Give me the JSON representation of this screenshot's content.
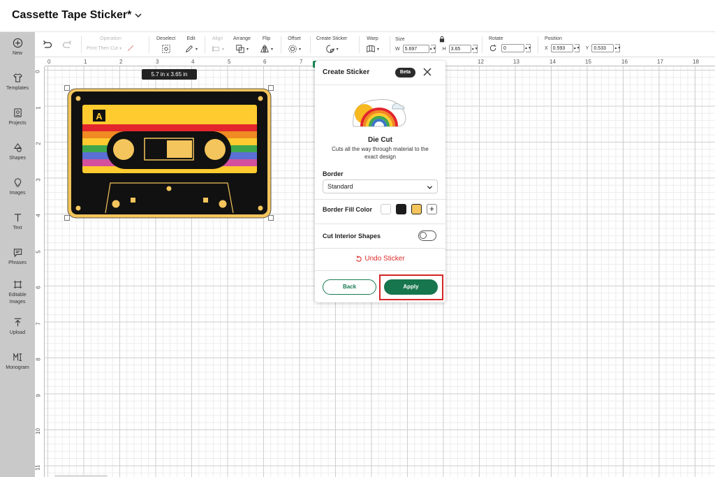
{
  "header": {
    "title": "Cassette Tape Sticker*"
  },
  "rail": [
    {
      "label": "New",
      "icon": "plus-circle-icon"
    },
    {
      "label": "Templates",
      "icon": "shirt-icon"
    },
    {
      "label": "Projects",
      "icon": "projects-icon"
    },
    {
      "label": "Shapes",
      "icon": "shapes-icon"
    },
    {
      "label": "Images",
      "icon": "lightbulb-icon"
    },
    {
      "label": "Text",
      "icon": "text-icon"
    },
    {
      "label": "Phrases",
      "icon": "speech-bubble-icon"
    },
    {
      "label": "Editable Images",
      "icon": "editable-images-icon"
    },
    {
      "label": "Upload",
      "icon": "upload-icon"
    },
    {
      "label": "Monogram",
      "icon": "monogram-icon"
    }
  ],
  "toolbar": {
    "operation_label": "Operation",
    "operation_value": "Print Then Cut",
    "deselect_label": "Deselect",
    "edit_label": "Edit",
    "align_label": "Align",
    "arrange_label": "Arrange",
    "flip_label": "Flip",
    "offset_label": "Offset",
    "create_sticker_label": "Create Sticker",
    "warp_label": "Warp",
    "size_label": "Size",
    "size_w_label": "W",
    "size_w": "5.697",
    "size_h_label": "H",
    "size_h": "3.65",
    "rotate_label": "Rotate",
    "rotate_value": "0",
    "position_label": "Position",
    "position_x_label": "X",
    "position_x": "0.593",
    "position_y_label": "Y",
    "position_y": "0.533"
  },
  "ruler": {
    "top": [
      "0",
      "1",
      "2",
      "3",
      "4",
      "5",
      "6",
      "7",
      "12",
      "13",
      "14",
      "15",
      "16",
      "17",
      "18"
    ],
    "left": [
      "0",
      "1",
      "2",
      "3",
      "4",
      "5",
      "6",
      "7",
      "8",
      "9",
      "10",
      "11"
    ]
  },
  "canvas": {
    "size_badge": "5.7  in x 3.65  in",
    "sticker_label_letter": "A"
  },
  "panel": {
    "title": "Create Sticker",
    "badge": "Beta",
    "cut_title": "Die Cut",
    "cut_desc": "Cuts all the way through material to the exact design",
    "border_label": "Border",
    "border_value": "Standard",
    "fill_label": "Border Fill Color",
    "fill_colors": [
      "#ffffff",
      "#1c1c1c",
      "#f4c55c"
    ],
    "interior_label": "Cut Interior Shapes",
    "interior_on": false,
    "undo_label": "Undo Sticker",
    "back_label": "Back",
    "apply_label": "Apply"
  },
  "colors": {
    "accent_green": "#17764d",
    "undo_red": "#e02b2b",
    "highlight_red": "#d62525",
    "sticker_gold": "#f4c55c",
    "sticker_yellow": "#ffcb2f"
  }
}
